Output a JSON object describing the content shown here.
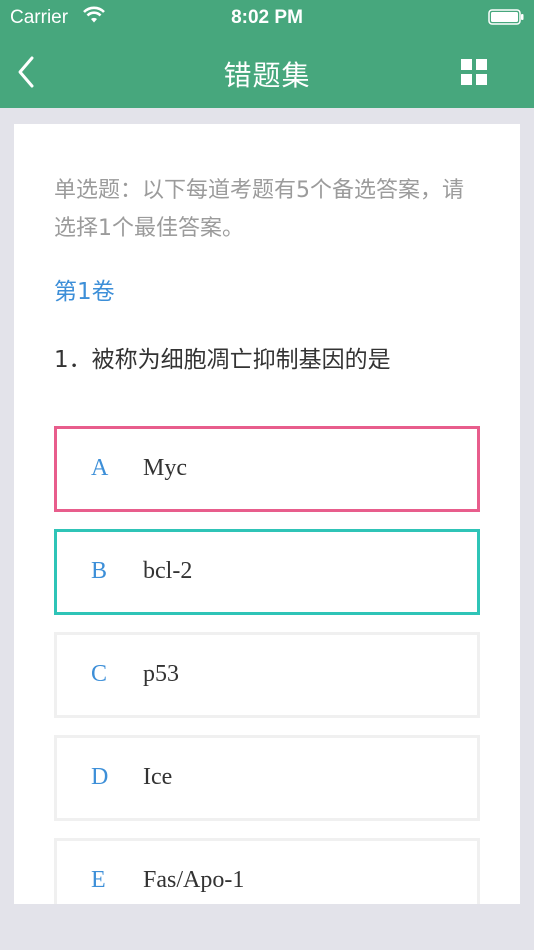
{
  "status_bar": {
    "carrier": "Carrier",
    "time": "8:02 PM"
  },
  "header": {
    "title": "错题集",
    "back_icon": "chevron-left-icon",
    "menu_icon": "grid-icon"
  },
  "card": {
    "description": "单选题：以下每道考题有5个备选答案，请选择1个最佳答案。",
    "volume": "第1卷",
    "question": "1．被称为细胞凋亡抑制基因的是",
    "options": [
      {
        "letter": "A",
        "text": "Myc",
        "state": "wrong"
      },
      {
        "letter": "B",
        "text": "bcl-2",
        "state": "correct"
      },
      {
        "letter": "C",
        "text": "p53",
        "state": "normal"
      },
      {
        "letter": "D",
        "text": "Ice",
        "state": "normal"
      },
      {
        "letter": "E",
        "text": "Fas/Apo-1",
        "state": "normal"
      }
    ]
  },
  "colors": {
    "header": "#47a77d",
    "wrong": "#e85d8c",
    "correct": "#2fc4b7",
    "accent": "#3d8fd8"
  }
}
